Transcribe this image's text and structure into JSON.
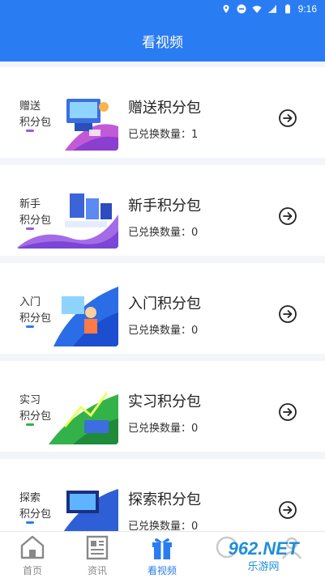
{
  "status_bar": {
    "time": "9:16"
  },
  "header": {
    "title": "看视频"
  },
  "packages": [
    {
      "thumb_label": "赠送\n积分包",
      "title": "赠送积分包",
      "exchanged": "已兑换数量：1",
      "theme": "pink"
    },
    {
      "thumb_label": "新手\n积分包",
      "title": "新手积分包",
      "exchanged": "已兑换数量：0",
      "theme": "purple"
    },
    {
      "thumb_label": "入门\n积分包",
      "title": "入门积分包",
      "exchanged": "已兑换数量：0",
      "theme": "blue"
    },
    {
      "thumb_label": "实习\n积分包",
      "title": "实习积分包",
      "exchanged": "已兑换数量：0",
      "theme": "green"
    },
    {
      "thumb_label": "探索\n积分包",
      "title": "探索积分包",
      "exchanged": "已兑换数量：0",
      "theme": "navy"
    }
  ],
  "tabs": [
    {
      "label": "首页",
      "icon": "home-icon",
      "active": false
    },
    {
      "label": "资讯",
      "icon": "news-icon",
      "active": false
    },
    {
      "label": "看视频",
      "icon": "gift-icon",
      "active": true
    },
    {
      "label": "",
      "icon": "profile-icon",
      "active": false
    },
    {
      "label": "",
      "icon": "user-icon",
      "active": false
    }
  ],
  "watermark": {
    "text": "962.NET",
    "subtext": "乐游网"
  },
  "colors": {
    "primary": "#2a7cf2",
    "background": "#f2f5fa"
  }
}
